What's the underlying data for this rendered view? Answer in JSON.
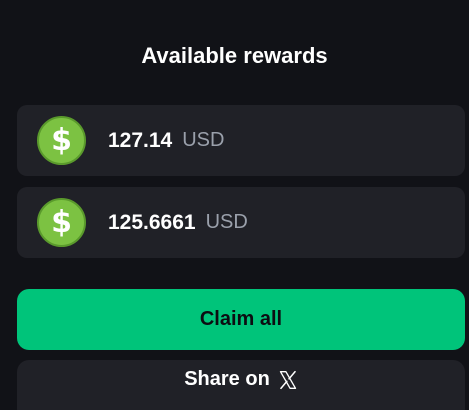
{
  "title": "Available rewards",
  "rewards": [
    {
      "icon": "dollar-coin-icon",
      "amount": "127.14",
      "currency": "USD"
    },
    {
      "icon": "dollar-coin-icon",
      "amount": "125.6661",
      "currency": "USD"
    }
  ],
  "coin_glyph": "$",
  "buttons": {
    "claim_label": "Claim all",
    "share_label": "Share on",
    "share_icon": "x-logo-icon"
  },
  "colors": {
    "background": "#111217",
    "card": "#202127",
    "accent": "#00c47a",
    "coin": "#7cc242"
  }
}
